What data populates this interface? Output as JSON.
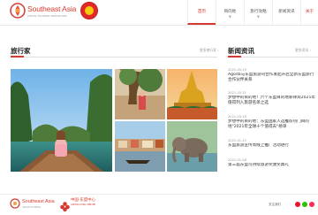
{
  "header": {
    "brand_title": "Southeast Asia",
    "brand_subtitle": "ASEAN TOURISM PROMOTION",
    "nav": [
      {
        "label": "首页",
        "has_caret": false
      },
      {
        "label": "目的地",
        "has_caret": true
      },
      {
        "label": "旅行攻略",
        "has_caret": true
      },
      {
        "label": "新闻资讯",
        "has_caret": false
      },
      {
        "label": "关于",
        "has_caret": false
      }
    ]
  },
  "travelers": {
    "title": "旅行家",
    "more": "更多旅行家 ›"
  },
  "news": {
    "title": "新闻资讯",
    "more": "更多资讯 ›",
    "items": [
      {
        "date": "2021-05-19",
        "title": "Agoda与东盟旅游司合作发起开启全新东盟旅行合作伙伴关系"
      },
      {
        "date": "2021-03-31",
        "title": "梦想中的目的地！六个东盟目的地菲律宾2021年值得列入旅游名单之选"
      },
      {
        "date": "2021-03-18",
        "title": "梦想中的目的地：东盟国家入选推荐热门目的地\"2021年全球十个值得去\"榜单"
      },
      {
        "date": "2021-01-15",
        "title": "东盟旅游宣传周线上推广活动进行"
      },
      {
        "date": "2021-01-08",
        "title": "第三届东盟可持续旅游奖颁奖典礼"
      }
    ]
  },
  "footer": {
    "brand_title": "Southeast Asia",
    "brand_subtitle": "ASEAN TOURISM",
    "partner_line1": "中国-东盟中心",
    "partner_line2": "ASEAN-CHINA CENTRE",
    "social_label": "关注我们"
  },
  "colors": {
    "brand_red": "#d43a2f",
    "asean_red": "#e02a2a",
    "asean_yellow": "#f6c80e"
  }
}
